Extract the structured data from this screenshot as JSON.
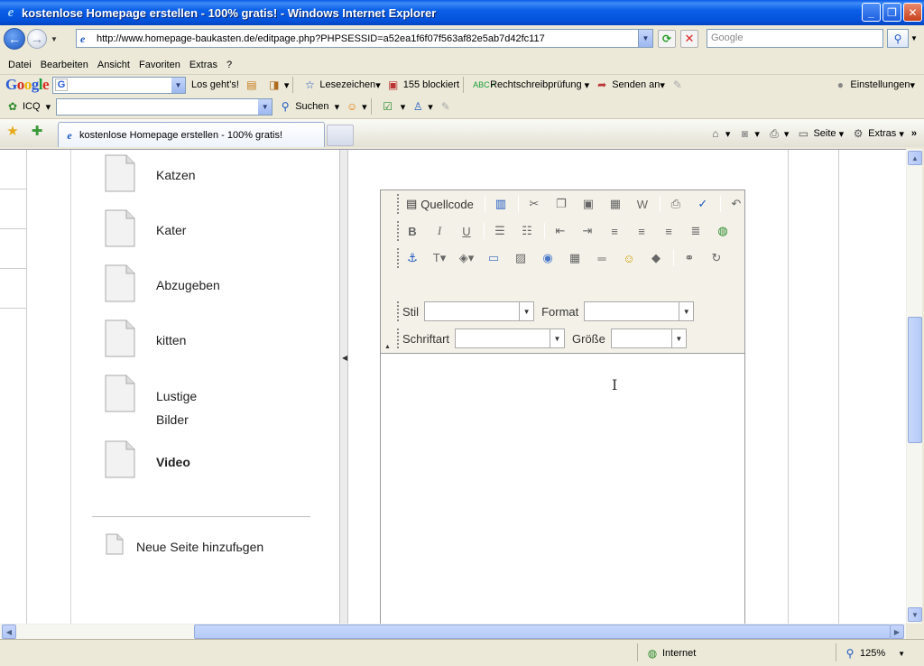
{
  "window": {
    "title": "kostenlose Homepage erstellen - 100% gratis! - Windows Internet Explorer",
    "minimize": "_",
    "maximize": "❐",
    "close": "✕"
  },
  "address": {
    "url": "http://www.homepage-baukasten.de/editpage.php?PHPSESSID=a52ea1f6f07f563af82e5ab7d42fc117",
    "search_placeholder": "Google"
  },
  "menu": [
    "Datei",
    "Bearbeiten",
    "Ansicht",
    "Favoriten",
    "Extras",
    "?"
  ],
  "google_toolbar": {
    "go_label": "Los geht's!",
    "bookmarks": "Lesezeichen",
    "blocked": "155 blockiert",
    "spellcheck": "Rechtschreibprüfung",
    "send": "Senden an",
    "settings": "Einstellungen"
  },
  "icq_toolbar": {
    "label": "ICQ",
    "search": "Suchen"
  },
  "tab": {
    "title": "kostenlose Homepage erstellen - 100% gratis!",
    "page": "Seite",
    "extras": "Extras"
  },
  "pages": {
    "items": [
      {
        "label": "Katzen"
      },
      {
        "label": "Kater"
      },
      {
        "label": "Abzugeben"
      },
      {
        "label": "kitten"
      },
      {
        "label_line1": "Lustige",
        "label_line2": "Bilder"
      },
      {
        "label": "Video"
      }
    ],
    "add_page": "Neue Seite hinzufьgen"
  },
  "editor": {
    "source_label": "Quellcode",
    "style_label": "Stil",
    "format_label": "Format",
    "font_label": "Schriftart",
    "size_label": "Größe"
  },
  "status": {
    "zone": "Internet",
    "zoom": "125%"
  }
}
